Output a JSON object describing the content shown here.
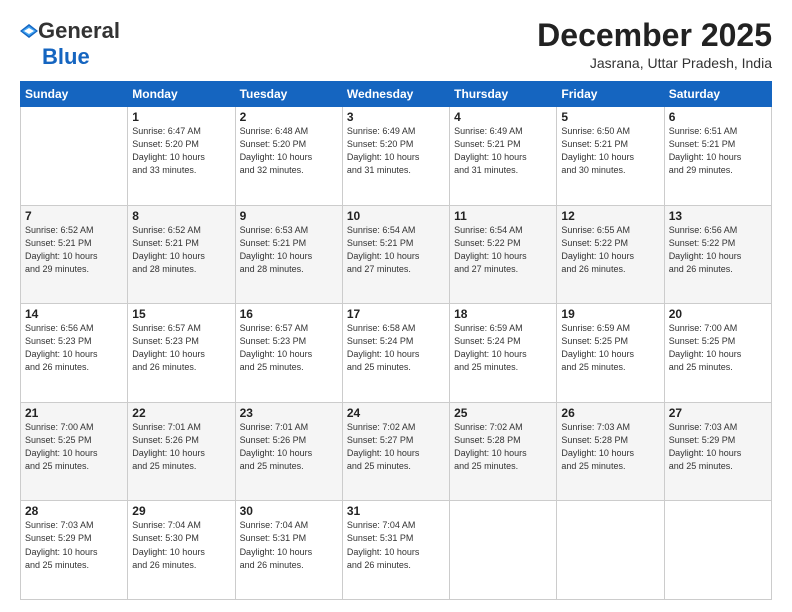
{
  "header": {
    "logo_general": "General",
    "logo_blue": "Blue",
    "month": "December 2025",
    "location": "Jasrana, Uttar Pradesh, India"
  },
  "weekdays": [
    "Sunday",
    "Monday",
    "Tuesday",
    "Wednesday",
    "Thursday",
    "Friday",
    "Saturday"
  ],
  "weeks": [
    [
      {
        "day": "",
        "detail": ""
      },
      {
        "day": "1",
        "detail": "Sunrise: 6:47 AM\nSunset: 5:20 PM\nDaylight: 10 hours\nand 33 minutes."
      },
      {
        "day": "2",
        "detail": "Sunrise: 6:48 AM\nSunset: 5:20 PM\nDaylight: 10 hours\nand 32 minutes."
      },
      {
        "day": "3",
        "detail": "Sunrise: 6:49 AM\nSunset: 5:20 PM\nDaylight: 10 hours\nand 31 minutes."
      },
      {
        "day": "4",
        "detail": "Sunrise: 6:49 AM\nSunset: 5:21 PM\nDaylight: 10 hours\nand 31 minutes."
      },
      {
        "day": "5",
        "detail": "Sunrise: 6:50 AM\nSunset: 5:21 PM\nDaylight: 10 hours\nand 30 minutes."
      },
      {
        "day": "6",
        "detail": "Sunrise: 6:51 AM\nSunset: 5:21 PM\nDaylight: 10 hours\nand 29 minutes."
      }
    ],
    [
      {
        "day": "7",
        "detail": "Sunrise: 6:52 AM\nSunset: 5:21 PM\nDaylight: 10 hours\nand 29 minutes."
      },
      {
        "day": "8",
        "detail": "Sunrise: 6:52 AM\nSunset: 5:21 PM\nDaylight: 10 hours\nand 28 minutes."
      },
      {
        "day": "9",
        "detail": "Sunrise: 6:53 AM\nSunset: 5:21 PM\nDaylight: 10 hours\nand 28 minutes."
      },
      {
        "day": "10",
        "detail": "Sunrise: 6:54 AM\nSunset: 5:21 PM\nDaylight: 10 hours\nand 27 minutes."
      },
      {
        "day": "11",
        "detail": "Sunrise: 6:54 AM\nSunset: 5:22 PM\nDaylight: 10 hours\nand 27 minutes."
      },
      {
        "day": "12",
        "detail": "Sunrise: 6:55 AM\nSunset: 5:22 PM\nDaylight: 10 hours\nand 26 minutes."
      },
      {
        "day": "13",
        "detail": "Sunrise: 6:56 AM\nSunset: 5:22 PM\nDaylight: 10 hours\nand 26 minutes."
      }
    ],
    [
      {
        "day": "14",
        "detail": "Sunrise: 6:56 AM\nSunset: 5:23 PM\nDaylight: 10 hours\nand 26 minutes."
      },
      {
        "day": "15",
        "detail": "Sunrise: 6:57 AM\nSunset: 5:23 PM\nDaylight: 10 hours\nand 26 minutes."
      },
      {
        "day": "16",
        "detail": "Sunrise: 6:57 AM\nSunset: 5:23 PM\nDaylight: 10 hours\nand 25 minutes."
      },
      {
        "day": "17",
        "detail": "Sunrise: 6:58 AM\nSunset: 5:24 PM\nDaylight: 10 hours\nand 25 minutes."
      },
      {
        "day": "18",
        "detail": "Sunrise: 6:59 AM\nSunset: 5:24 PM\nDaylight: 10 hours\nand 25 minutes."
      },
      {
        "day": "19",
        "detail": "Sunrise: 6:59 AM\nSunset: 5:25 PM\nDaylight: 10 hours\nand 25 minutes."
      },
      {
        "day": "20",
        "detail": "Sunrise: 7:00 AM\nSunset: 5:25 PM\nDaylight: 10 hours\nand 25 minutes."
      }
    ],
    [
      {
        "day": "21",
        "detail": "Sunrise: 7:00 AM\nSunset: 5:25 PM\nDaylight: 10 hours\nand 25 minutes."
      },
      {
        "day": "22",
        "detail": "Sunrise: 7:01 AM\nSunset: 5:26 PM\nDaylight: 10 hours\nand 25 minutes."
      },
      {
        "day": "23",
        "detail": "Sunrise: 7:01 AM\nSunset: 5:26 PM\nDaylight: 10 hours\nand 25 minutes."
      },
      {
        "day": "24",
        "detail": "Sunrise: 7:02 AM\nSunset: 5:27 PM\nDaylight: 10 hours\nand 25 minutes."
      },
      {
        "day": "25",
        "detail": "Sunrise: 7:02 AM\nSunset: 5:28 PM\nDaylight: 10 hours\nand 25 minutes."
      },
      {
        "day": "26",
        "detail": "Sunrise: 7:03 AM\nSunset: 5:28 PM\nDaylight: 10 hours\nand 25 minutes."
      },
      {
        "day": "27",
        "detail": "Sunrise: 7:03 AM\nSunset: 5:29 PM\nDaylight: 10 hours\nand 25 minutes."
      }
    ],
    [
      {
        "day": "28",
        "detail": "Sunrise: 7:03 AM\nSunset: 5:29 PM\nDaylight: 10 hours\nand 25 minutes."
      },
      {
        "day": "29",
        "detail": "Sunrise: 7:04 AM\nSunset: 5:30 PM\nDaylight: 10 hours\nand 26 minutes."
      },
      {
        "day": "30",
        "detail": "Sunrise: 7:04 AM\nSunset: 5:31 PM\nDaylight: 10 hours\nand 26 minutes."
      },
      {
        "day": "31",
        "detail": "Sunrise: 7:04 AM\nSunset: 5:31 PM\nDaylight: 10 hours\nand 26 minutes."
      },
      {
        "day": "",
        "detail": ""
      },
      {
        "day": "",
        "detail": ""
      },
      {
        "day": "",
        "detail": ""
      }
    ]
  ]
}
